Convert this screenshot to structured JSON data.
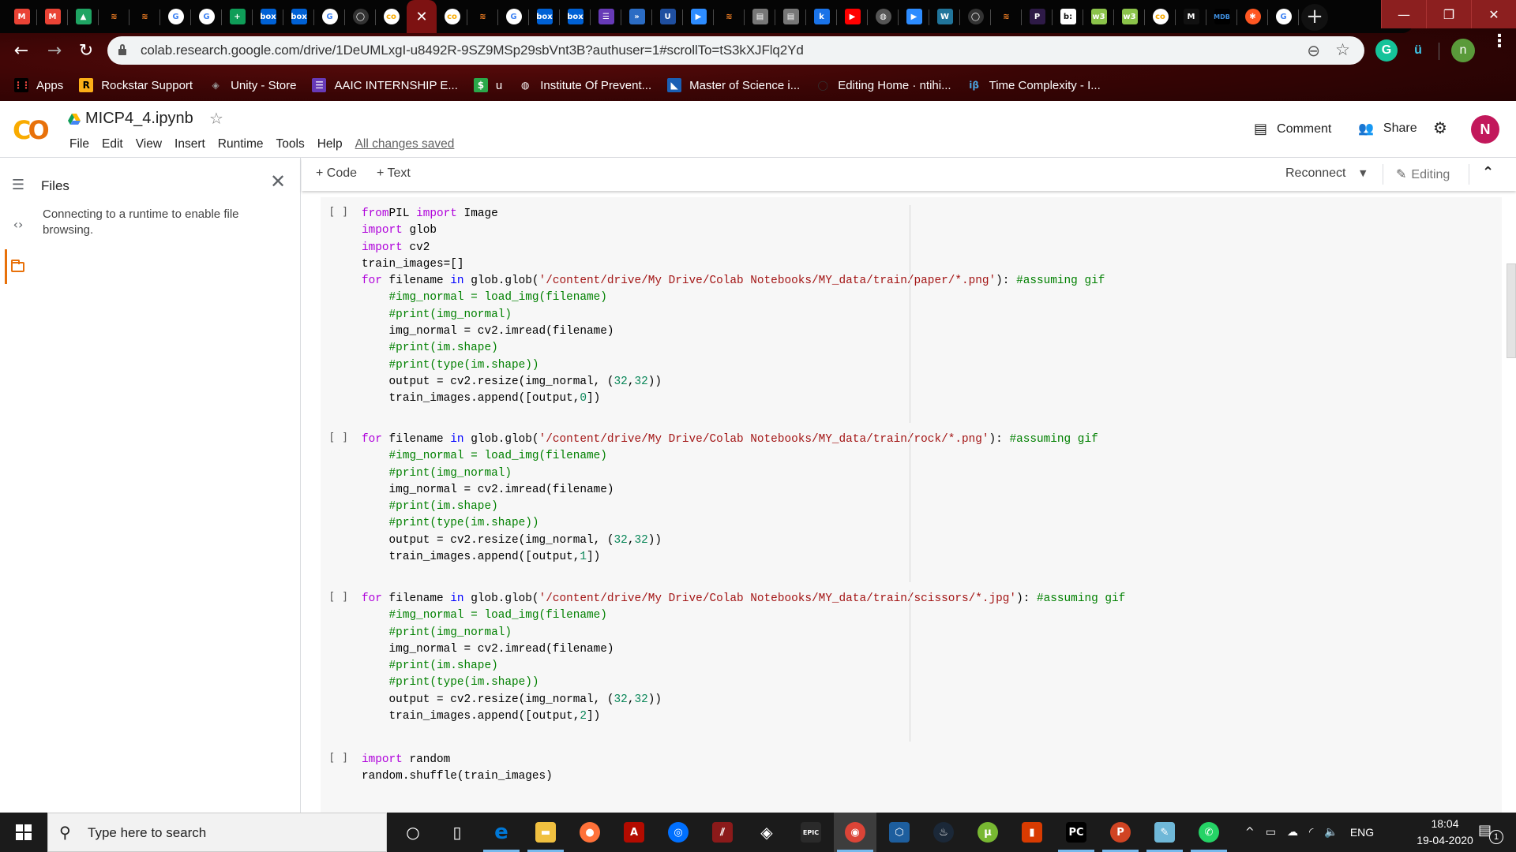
{
  "browser": {
    "tabs": [
      {
        "icon": "gmail-icon",
        "color": "#ea4335",
        "glyph": "M"
      },
      {
        "icon": "gmail-icon",
        "color": "#ea4335",
        "glyph": "M"
      },
      {
        "icon": "google-drive-icon",
        "color": "#1fa463",
        "glyph": "▲"
      },
      {
        "icon": "stackoverflow-icon",
        "color": "#f48024",
        "glyph": "≋"
      },
      {
        "icon": "stackoverflow-icon",
        "color": "#f48024",
        "glyph": "≋"
      },
      {
        "icon": "google-icon",
        "color": "#4285f4",
        "glyph": "G"
      },
      {
        "icon": "google-icon",
        "color": "#4285f4",
        "glyph": "G"
      },
      {
        "icon": "google-classroom-icon",
        "color": "#0f9d58",
        "glyph": "+"
      },
      {
        "icon": "box-icon",
        "color": "#0061d5",
        "glyph": "box"
      },
      {
        "icon": "box-icon",
        "color": "#0061d5",
        "glyph": "box"
      },
      {
        "icon": "google-icon",
        "color": "#4285f4",
        "glyph": "G"
      },
      {
        "icon": "github-icon",
        "color": "#333333",
        "glyph": "◯"
      },
      {
        "icon": "colab-icon",
        "color": "#f9ab00",
        "glyph": "co"
      },
      {
        "icon": "close-icon",
        "color": "#7d1212",
        "glyph": "✕",
        "active": true
      },
      {
        "icon": "colab-icon",
        "color": "#f9ab00",
        "glyph": "co"
      },
      {
        "icon": "stackoverflow-icon",
        "color": "#f48024",
        "glyph": "≋"
      },
      {
        "icon": "google-icon",
        "color": "#4285f4",
        "glyph": "G"
      },
      {
        "icon": "box-icon",
        "color": "#0061d5",
        "glyph": "box"
      },
      {
        "icon": "box-icon",
        "color": "#0061d5",
        "glyph": "box"
      },
      {
        "icon": "google-forms-icon",
        "color": "#673ab7",
        "glyph": "☰"
      },
      {
        "icon": "site-icon",
        "color": "#2b6cc4",
        "glyph": "»"
      },
      {
        "icon": "umkc-icon",
        "color": "#1f4fa0",
        "glyph": "U"
      },
      {
        "icon": "zoom-icon",
        "color": "#2d8cff",
        "glyph": "▶"
      },
      {
        "icon": "stackoverflow-icon",
        "color": "#f48024",
        "glyph": "≋"
      },
      {
        "icon": "page-icon",
        "color": "#777777",
        "glyph": "▤"
      },
      {
        "icon": "page-icon",
        "color": "#777777",
        "glyph": "▤"
      },
      {
        "icon": "k-icon",
        "color": "#1a73e8",
        "glyph": "k"
      },
      {
        "icon": "youtube-icon",
        "color": "#ff0000",
        "glyph": "▶"
      },
      {
        "icon": "globe-icon",
        "color": "#555555",
        "glyph": "◍"
      },
      {
        "icon": "zoom-icon",
        "color": "#2d8cff",
        "glyph": "▶"
      },
      {
        "icon": "wordpress-icon",
        "color": "#21759b",
        "glyph": "W"
      },
      {
        "icon": "github-icon",
        "color": "#333333",
        "glyph": "◯"
      },
      {
        "icon": "stackoverflow-icon",
        "color": "#f48024",
        "glyph": "≋"
      },
      {
        "icon": "pluralsight-icon",
        "color": "#2e1a47",
        "glyph": "P"
      },
      {
        "icon": "bitly-icon",
        "color": "#ffffff",
        "glyph": "b:"
      },
      {
        "icon": "w3schools-icon",
        "color": "#8bc34a",
        "glyph": "w3"
      },
      {
        "icon": "w3schools-icon",
        "color": "#8bc34a",
        "glyph": "w3"
      },
      {
        "icon": "colab-icon",
        "color": "#f9ab00",
        "glyph": "co"
      },
      {
        "icon": "medium-icon",
        "color": "#111111",
        "glyph": "M"
      },
      {
        "icon": "mdb-icon",
        "color": "#000000",
        "glyph": "MDB"
      },
      {
        "icon": "asterisk-app-icon",
        "color": "#ff5722",
        "glyph": "✱"
      },
      {
        "icon": "google-icon",
        "color": "#4285f4",
        "glyph": "G"
      }
    ],
    "new_tab_label": "+",
    "window_controls": {
      "minimize": "—",
      "restore": "❐",
      "close": "✕"
    },
    "url": "colab.research.google.com/drive/1DeUMLxgI-u8492R-9SZ9MSp29sbVnt3B?authuser=1#scrollTo=tS3kXJFlq2Yd",
    "profile_initial": "n",
    "bookmarks": [
      {
        "label": "Apps",
        "icon": "apps-grid-icon"
      },
      {
        "label": "Rockstar Support",
        "icon": "rockstar-icon"
      },
      {
        "label": "Unity - Store",
        "icon": "unity-icon"
      },
      {
        "label": "AAIC INTERNSHIP E...",
        "icon": "google-forms-icon"
      },
      {
        "label": "u",
        "icon": "dollar-icon"
      },
      {
        "label": "Institute Of Prevent...",
        "icon": "globe-icon"
      },
      {
        "label": "Master of Science i...",
        "icon": "university-icon"
      },
      {
        "label": "Editing Home · ntihi...",
        "icon": "github-icon"
      },
      {
        "label": "Time Complexity - I...",
        "icon": "interviewbit-icon"
      }
    ]
  },
  "colab": {
    "notebook_title": "MICP4_4.ipynb",
    "menu": [
      "File",
      "Edit",
      "View",
      "Insert",
      "Runtime",
      "Tools",
      "Help"
    ],
    "save_status": "All changes saved",
    "comment_label": "Comment",
    "share_label": "Share",
    "avatar_initial": "N",
    "sidebar": {
      "title": "Files",
      "message": "Connecting to a runtime to enable file browsing."
    },
    "toolbar": {
      "add_code": "+ Code",
      "add_text": "+ Text",
      "reconnect": "Reconnect",
      "editing": "Editing"
    },
    "cells": [
      {
        "gutter": "[ ]",
        "lines": [
          [
            [
              "kw",
              "from"
            ],
            [
              "",
              "PIL "
            ],
            [
              "kw",
              "import"
            ],
            [
              "",
              " Image"
            ]
          ],
          [
            [
              "kw",
              "import"
            ],
            [
              "",
              " glob"
            ]
          ],
          [
            [
              "kw",
              "import"
            ],
            [
              "",
              " cv2"
            ]
          ],
          [
            [
              "",
              "train_images=[]"
            ]
          ],
          [
            [
              "kw",
              "for"
            ],
            [
              "",
              " filename "
            ],
            [
              "kw2",
              "in"
            ],
            [
              "",
              " glob.glob("
            ],
            [
              "st",
              "'/content/drive/My Drive/Colab Notebooks/MY_data/train/paper/*.png'"
            ],
            [
              "",
              "): "
            ],
            [
              "cm",
              "#assuming gif"
            ]
          ],
          [
            [
              "",
              "    "
            ],
            [
              "cm",
              "#img_normal = load_img(filename)"
            ]
          ],
          [
            [
              "",
              "    "
            ],
            [
              "cm",
              "#print(img_normal)"
            ]
          ],
          [
            [
              "",
              "    img_normal = cv2.imread(filename)"
            ]
          ],
          [
            [
              "",
              "    "
            ],
            [
              "cm",
              "#print(im.shape)"
            ]
          ],
          [
            [
              "",
              "    "
            ],
            [
              "cm",
              "#print(type(im.shape))"
            ]
          ],
          [
            [
              "",
              "    output = cv2.resize(img_normal, ("
            ],
            [
              "nu",
              "32"
            ],
            [
              "",
              ","
            ],
            [
              "nu",
              "32"
            ],
            [
              "",
              "))"
            ]
          ],
          [
            [
              "",
              "    train_images.append([output,"
            ],
            [
              "nu",
              "0"
            ],
            [
              "",
              "])"
            ]
          ]
        ]
      },
      {
        "gutter": "[ ]",
        "lines": [
          [
            [
              "kw",
              "for"
            ],
            [
              "",
              " filename "
            ],
            [
              "kw2",
              "in"
            ],
            [
              "",
              " glob.glob("
            ],
            [
              "st",
              "'/content/drive/My Drive/Colab Notebooks/MY_data/train/rock/*.png'"
            ],
            [
              "",
              "): "
            ],
            [
              "cm",
              "#assuming gif"
            ]
          ],
          [
            [
              "",
              "    "
            ],
            [
              "cm",
              "#img_normal = load_img(filename)"
            ]
          ],
          [
            [
              "",
              "    "
            ],
            [
              "cm",
              "#print(img_normal)"
            ]
          ],
          [
            [
              "",
              "    img_normal = cv2.imread(filename)"
            ]
          ],
          [
            [
              "",
              "    "
            ],
            [
              "cm",
              "#print(im.shape)"
            ]
          ],
          [
            [
              "",
              "    "
            ],
            [
              "cm",
              "#print(type(im.shape))"
            ]
          ],
          [
            [
              "",
              "    output = cv2.resize(img_normal, ("
            ],
            [
              "nu",
              "32"
            ],
            [
              "",
              ","
            ],
            [
              "nu",
              "32"
            ],
            [
              "",
              "))"
            ]
          ],
          [
            [
              "",
              "    train_images.append([output,"
            ],
            [
              "nu",
              "1"
            ],
            [
              "",
              "])"
            ]
          ]
        ]
      },
      {
        "gutter": "[ ]",
        "lines": [
          [
            [
              "kw",
              "for"
            ],
            [
              "",
              " filename "
            ],
            [
              "kw2",
              "in"
            ],
            [
              "",
              " glob.glob("
            ],
            [
              "st",
              "'/content/drive/My Drive/Colab Notebooks/MY_data/train/scissors/*.jpg'"
            ],
            [
              "",
              "): "
            ],
            [
              "cm",
              "#assuming gif"
            ]
          ],
          [
            [
              "",
              "    "
            ],
            [
              "cm",
              "#img_normal = load_img(filename)"
            ]
          ],
          [
            [
              "",
              "    "
            ],
            [
              "cm",
              "#print(img_normal)"
            ]
          ],
          [
            [
              "",
              "    img_normal = cv2.imread(filename)"
            ]
          ],
          [
            [
              "",
              "    "
            ],
            [
              "cm",
              "#print(im.shape)"
            ]
          ],
          [
            [
              "",
              "    "
            ],
            [
              "cm",
              "#print(type(im.shape))"
            ]
          ],
          [
            [
              "",
              "    output = cv2.resize(img_normal, ("
            ],
            [
              "nu",
              "32"
            ],
            [
              "",
              ","
            ],
            [
              "nu",
              "32"
            ],
            [
              "",
              "))"
            ]
          ],
          [
            [
              "",
              "    train_images.append([output,"
            ],
            [
              "nu",
              "2"
            ],
            [
              "",
              "])"
            ]
          ]
        ]
      },
      {
        "gutter": "[ ]",
        "lines": [
          [
            [
              "kw",
              "import"
            ],
            [
              "",
              " random"
            ]
          ],
          [
            [
              "",
              "random.shuffle(train_images)"
            ]
          ]
        ]
      }
    ]
  },
  "taskbar": {
    "search_placeholder": "Type here to search",
    "apps": [
      {
        "name": "cortana",
        "icon": "cortana-icon",
        "glyph": "○",
        "color": "transparent"
      },
      {
        "name": "task-view",
        "icon": "task-view-icon",
        "glyph": "▯",
        "color": "transparent"
      },
      {
        "name": "edge",
        "icon": "edge-icon",
        "glyph": "e",
        "color": "#0078d7",
        "running": true
      },
      {
        "name": "file-explorer",
        "icon": "folder-icon",
        "glyph": "▬",
        "color": "#f0c040",
        "running": true
      },
      {
        "name": "firefox",
        "icon": "firefox-icon",
        "glyph": "●",
        "color": "#ff7139"
      },
      {
        "name": "acrobat",
        "icon": "acrobat-icon",
        "glyph": "A",
        "color": "#b30b00"
      },
      {
        "name": "uplay",
        "icon": "uplay-icon",
        "glyph": "◎",
        "color": "#0070ff"
      },
      {
        "name": "game-app",
        "icon": "game-icon",
        "glyph": "⫽",
        "color": "#8b1a1a"
      },
      {
        "name": "unity",
        "icon": "unity-icon",
        "glyph": "◈",
        "color": "transparent"
      },
      {
        "name": "epic-games",
        "icon": "epic-games-icon",
        "glyph": "EPIC",
        "color": "#2a2a2a"
      },
      {
        "name": "chrome",
        "icon": "chrome-icon",
        "glyph": "◉",
        "color": "#db4437",
        "running": true,
        "active": true
      },
      {
        "name": "virtualbox",
        "icon": "virtualbox-icon",
        "glyph": "⬡",
        "color": "#1d5e9e"
      },
      {
        "name": "steam",
        "icon": "steam-icon",
        "glyph": "♨",
        "color": "#1b2838"
      },
      {
        "name": "utorrent",
        "icon": "utorrent-icon",
        "glyph": "µ",
        "color": "#78b832"
      },
      {
        "name": "office",
        "icon": "office-icon",
        "glyph": "▮",
        "color": "#d83b01"
      },
      {
        "name": "pycharm",
        "icon": "pycharm-icon",
        "glyph": "PC",
        "color": "#000000",
        "running": true
      },
      {
        "name": "powerpoint",
        "icon": "powerpoint-icon",
        "glyph": "P",
        "color": "#d04423",
        "running": true
      },
      {
        "name": "notepad",
        "icon": "notepad-icon",
        "glyph": "✎",
        "color": "#6fb8d8",
        "running": true
      },
      {
        "name": "whatsapp",
        "icon": "whatsapp-icon",
        "glyph": "✆",
        "color": "#25d366",
        "running": true
      }
    ],
    "language": "ENG",
    "time": "18:04",
    "date": "19-04-2020",
    "notification_count": "1"
  }
}
